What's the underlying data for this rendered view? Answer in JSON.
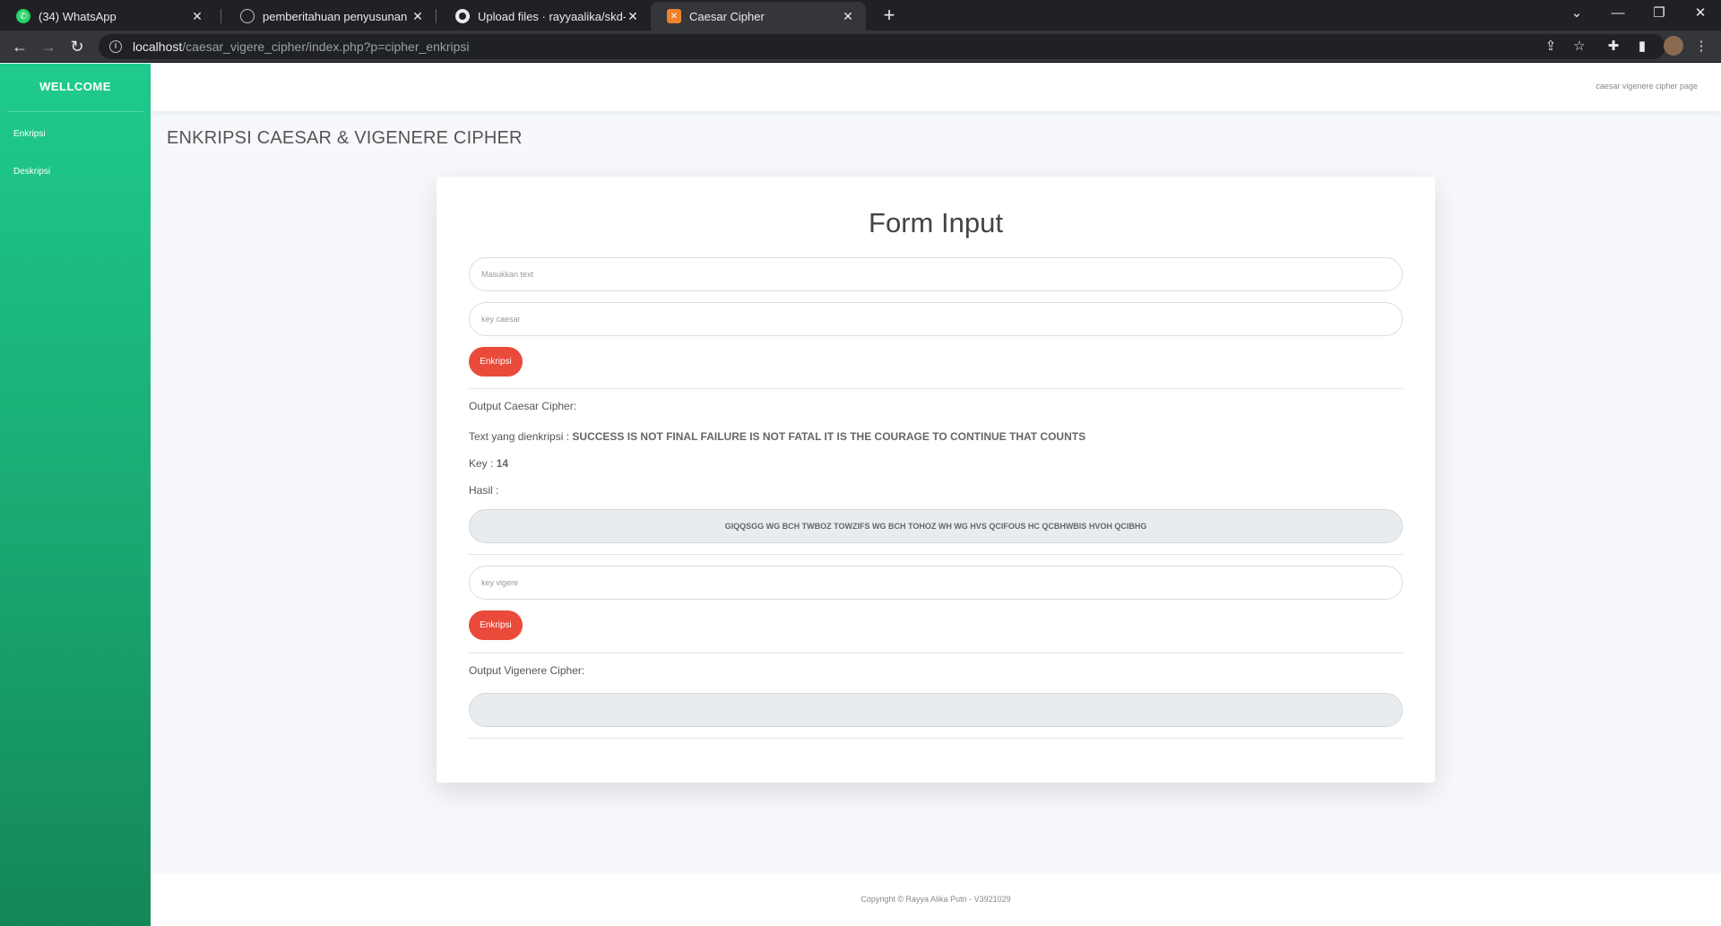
{
  "browser": {
    "tabs": [
      {
        "title": "(34) WhatsApp",
        "icon": "whatsapp-icon"
      },
      {
        "title": "pemberitahuan penyusunan penu",
        "icon": "globe-icon"
      },
      {
        "title": "Upload files · rayyaalika/skd-UTS",
        "icon": "github-icon"
      },
      {
        "title": "Caesar Cipher",
        "icon": "xampp-icon"
      }
    ],
    "url_host": "localhost",
    "url_path": "/caesar_vigere_cipher/index.php?p=cipher_enkripsi"
  },
  "sidebar": {
    "brand": "WELLCOME",
    "items": [
      {
        "label": "Enkripsi"
      },
      {
        "label": "Deskripsi"
      }
    ]
  },
  "topbar": {
    "right_text": "caesar vigenere cipher page"
  },
  "page": {
    "title": "ENKRIPSI CAESAR & VIGENERE CIPHER"
  },
  "form": {
    "heading": "Form Input",
    "text_placeholder": "Masukkan text",
    "caesar_key_placeholder": "key caesar",
    "encrypt_label": "Enkripsi",
    "caesar_output_label": "Output Caesar Cipher:",
    "encrypted_text_label": "Text yang dienkripsi :",
    "encrypted_text_value": "SUCCESS IS NOT FINAL FAILURE IS NOT FATAL IT IS THE COURAGE TO CONTINUE THAT COUNTS",
    "key_label": "Key :",
    "key_value": "14",
    "result_label": "Hasil :",
    "caesar_result": "GIQQSGG WG BCH TWBOZ TOWZIFS WG BCH TOHOZ WH WG HVS QCIFOUS HC QCBHWBIS HVOH QCIBHG",
    "vigenere_key_placeholder": "key vigere",
    "encrypt_label_2": "Enkripsi",
    "vigenere_output_label": "Output Vigenere Cipher:",
    "vigenere_result": ""
  },
  "footer": {
    "copyright": "Copyright © Rayya Alika Putri - V3921029"
  },
  "colors": {
    "sidebar_top": "#1fcb8c",
    "sidebar_bottom": "#148757",
    "button_red": "#ea4a3a"
  }
}
